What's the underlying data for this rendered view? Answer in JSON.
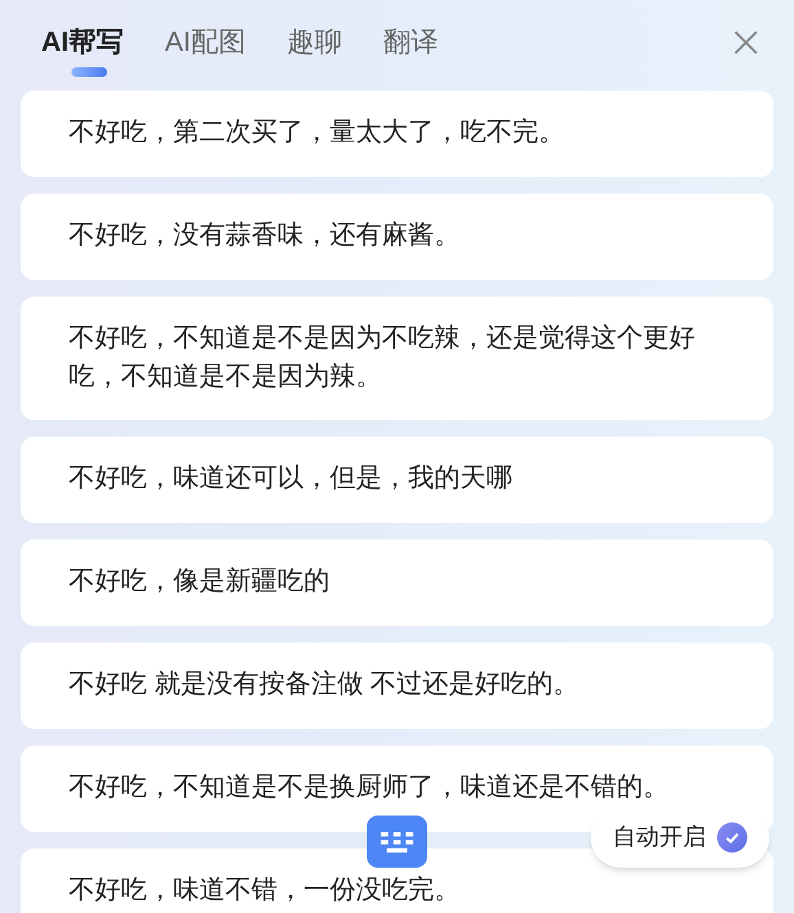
{
  "tabs": [
    {
      "label": "AI帮写",
      "selected": true
    },
    {
      "label": "AI配图",
      "selected": false
    },
    {
      "label": "趣聊",
      "selected": false
    },
    {
      "label": "翻译",
      "selected": false
    }
  ],
  "suggestions": [
    "不好吃，第二次买了，量太大了，吃不完。",
    "不好吃，没有蒜香味，还有麻酱。",
    "不好吃，不知道是不是因为不吃辣，还是觉得这个更好吃，不知道是不是因为辣。",
    "不好吃，味道还可以，但是，我的天哪",
    "不好吃，像是新疆吃的",
    "不好吃  就是没有按备注做  不过还是好吃的。",
    "不好吃，不知道是不是换厨师了，味道还是不错的。",
    "不好吃，味道不错，一份没吃完。"
  ],
  "auto_start": {
    "label": "自动开启",
    "checked": true
  }
}
